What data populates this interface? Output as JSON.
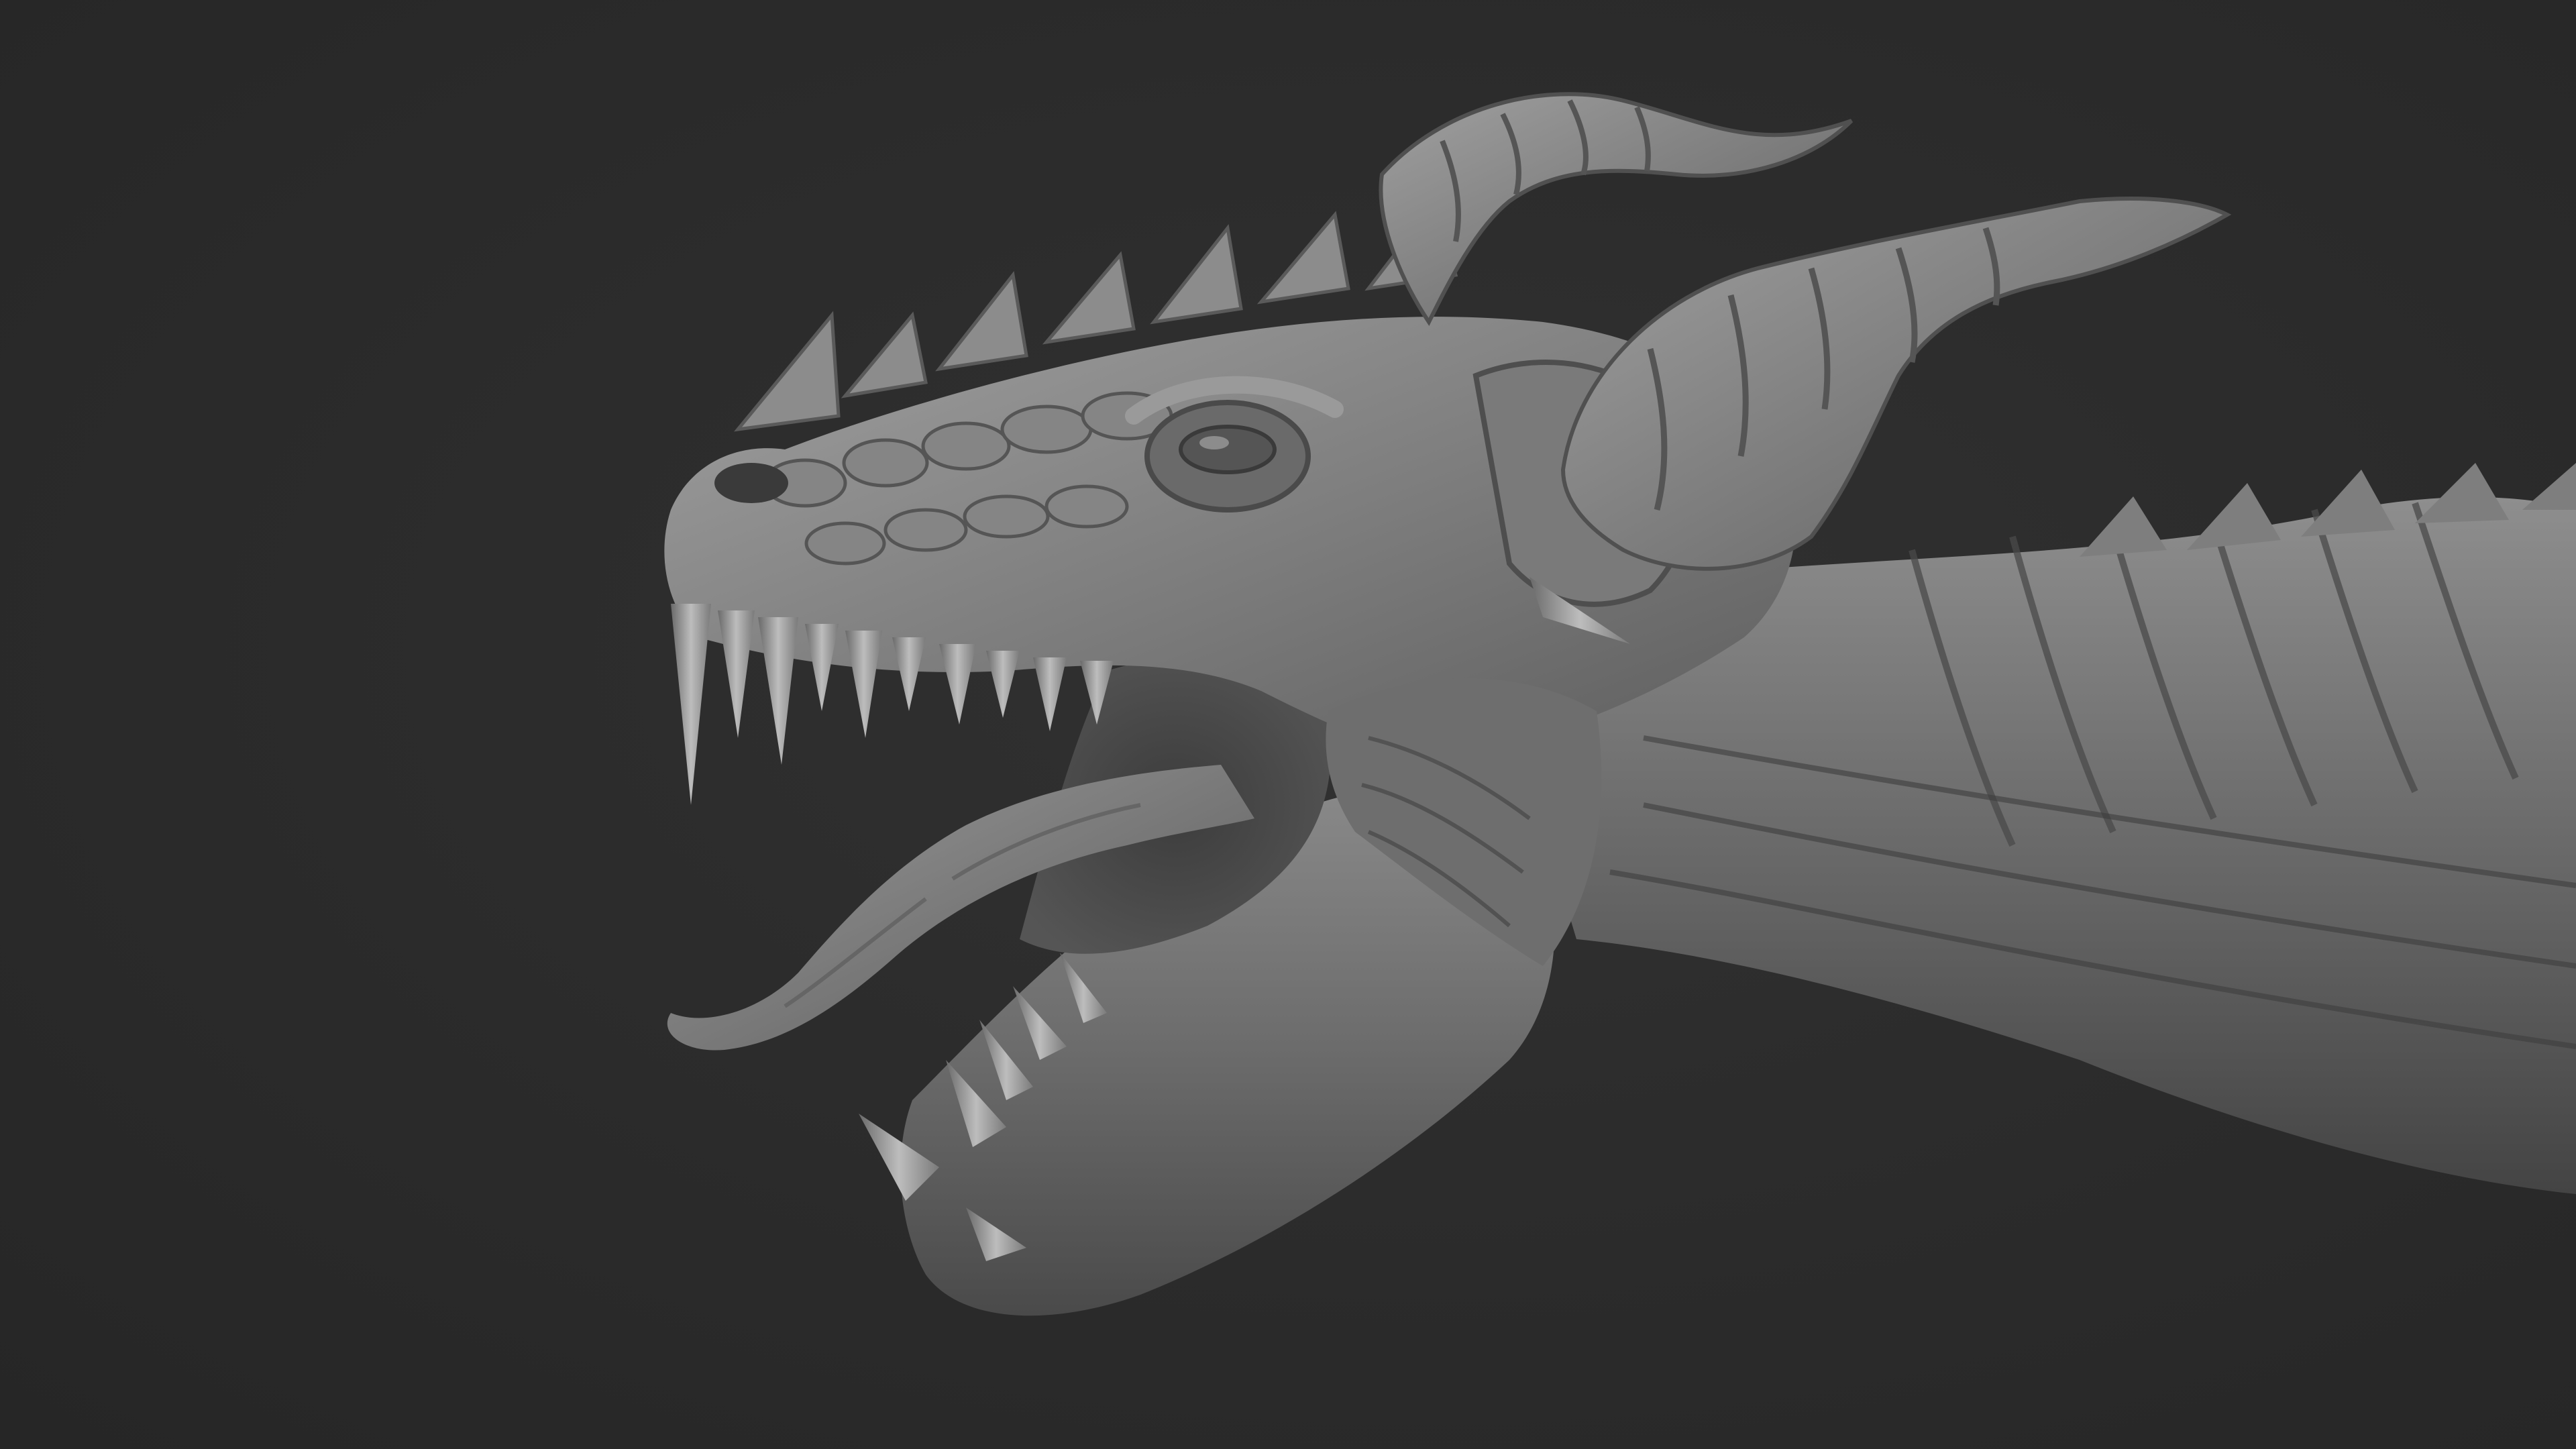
{
  "viewport": {
    "background_color": "#2b2b2b",
    "model_base_color": "#6e6e6e",
    "model_highlight_color": "#9a9a9a",
    "model_shadow_color": "#3a3a3a"
  },
  "model": {
    "subject": "dragon-head-sculpt",
    "material": "matte-gray-clay"
  }
}
